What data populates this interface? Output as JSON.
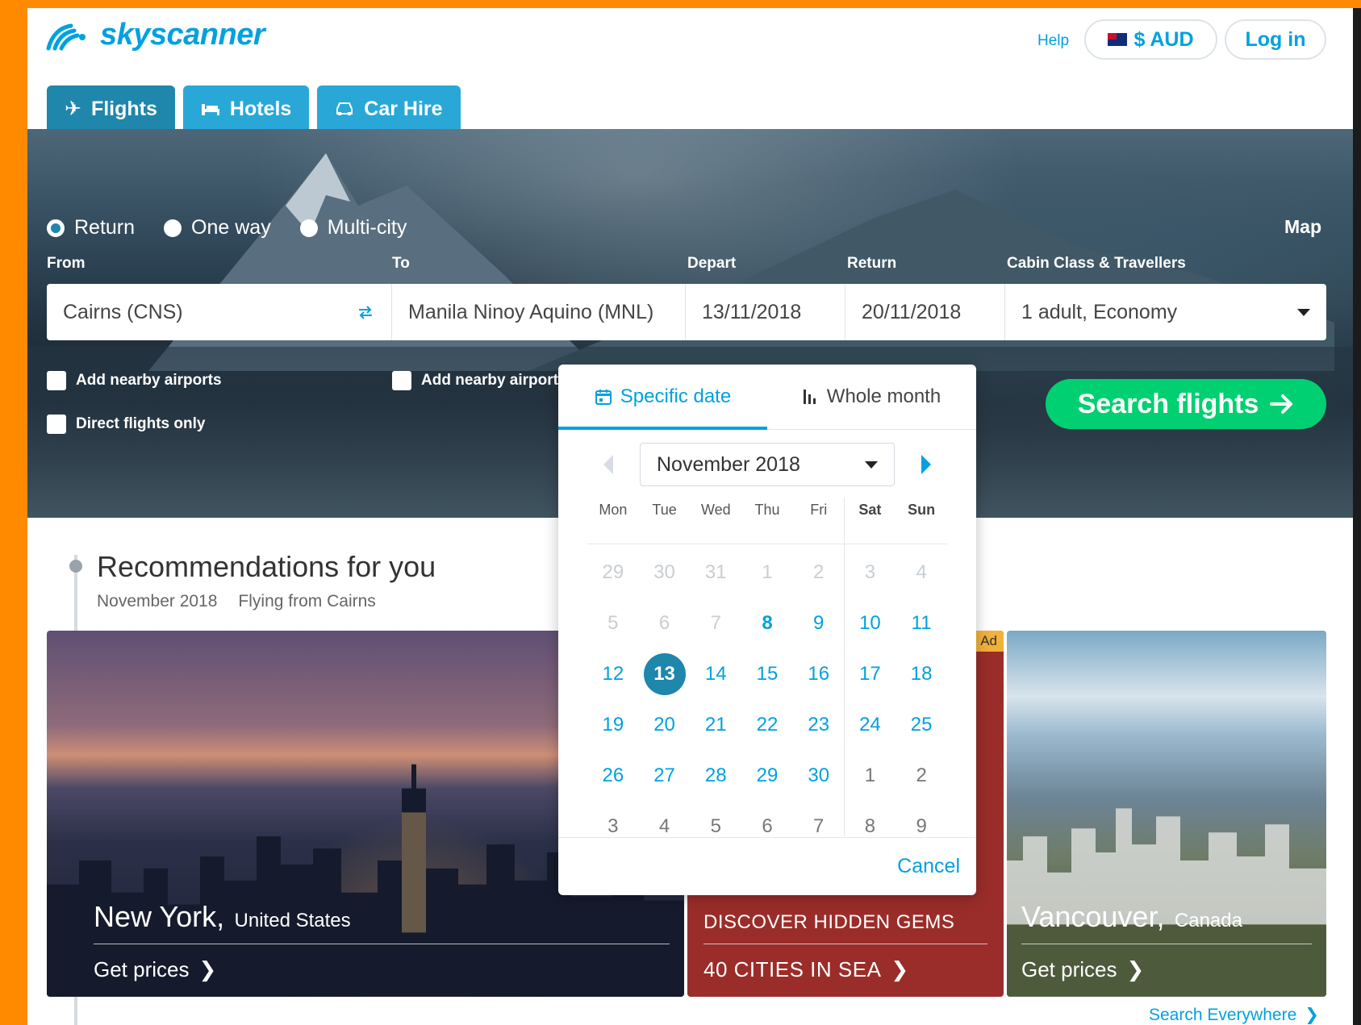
{
  "header": {
    "logo_text": "skyscanner",
    "help_label": "Help",
    "currency_label": "$ AUD",
    "login_label": "Log in"
  },
  "tabs": [
    {
      "label": "Flights",
      "icon": "plane-icon"
    },
    {
      "label": "Hotels",
      "icon": "bed-icon"
    },
    {
      "label": "Car Hire",
      "icon": "car-icon"
    }
  ],
  "trip_types": [
    {
      "label": "Return",
      "selected": true
    },
    {
      "label": "One way",
      "selected": false
    },
    {
      "label": "Multi-city",
      "selected": false
    }
  ],
  "map_label": "Map",
  "labels": {
    "from": "From",
    "to": "To",
    "depart": "Depart",
    "return": "Return",
    "cabin": "Cabin Class & Travellers"
  },
  "search": {
    "from_value": "Cairns (CNS)",
    "to_value": "Manila Ninoy Aquino (MNL)",
    "depart_value": "13/11/2018",
    "return_value": "20/11/2018",
    "cabin_value": "1 adult, Economy",
    "nearby_from_label": "Add nearby airports",
    "nearby_to_label": "Add nearby airports",
    "direct_label": "Direct flights only",
    "search_button_label": "Search flights"
  },
  "calendar": {
    "tab_specific": "Specific date",
    "tab_month": "Whole month",
    "month_label": "November 2018",
    "weekdays": [
      "Mon",
      "Tue",
      "Wed",
      "Thu",
      "Fri",
      "Sat",
      "Sun"
    ],
    "weeks": [
      [
        "29",
        "30",
        "31",
        "1",
        "2",
        "3",
        "4"
      ],
      [
        "5",
        "6",
        "7",
        "8",
        "9",
        "10",
        "11"
      ],
      [
        "12",
        "13",
        "14",
        "15",
        "16",
        "17",
        "18"
      ],
      [
        "19",
        "20",
        "21",
        "22",
        "23",
        "24",
        "25"
      ],
      [
        "26",
        "27",
        "28",
        "29",
        "30",
        "1",
        "2"
      ],
      [
        "3",
        "4",
        "5",
        "6",
        "7",
        "8",
        "9"
      ]
    ],
    "cancel_label": "Cancel"
  },
  "recommendations": {
    "title": "Recommendations for you",
    "subtitle_month": "November 2018",
    "subtitle_from": "Flying from Cairns",
    "cards": [
      {
        "city": "New York,",
        "country": "United States",
        "link": "Get prices"
      },
      {
        "ad_badge": "Ad",
        "line1": "DISCOVER HIDDEN GEMS",
        "line2": "40 CITIES IN SEA"
      },
      {
        "city": "Vancouver,",
        "country": "Canada",
        "link": "Get prices"
      }
    ],
    "search_everywhere": "Search Everywhere"
  },
  "colors": {
    "accent": "#00a1e0",
    "tab_active": "#1f86ac",
    "tab": "#29a8d8",
    "search_button": "#00d071",
    "frame": "#ff8a00"
  }
}
